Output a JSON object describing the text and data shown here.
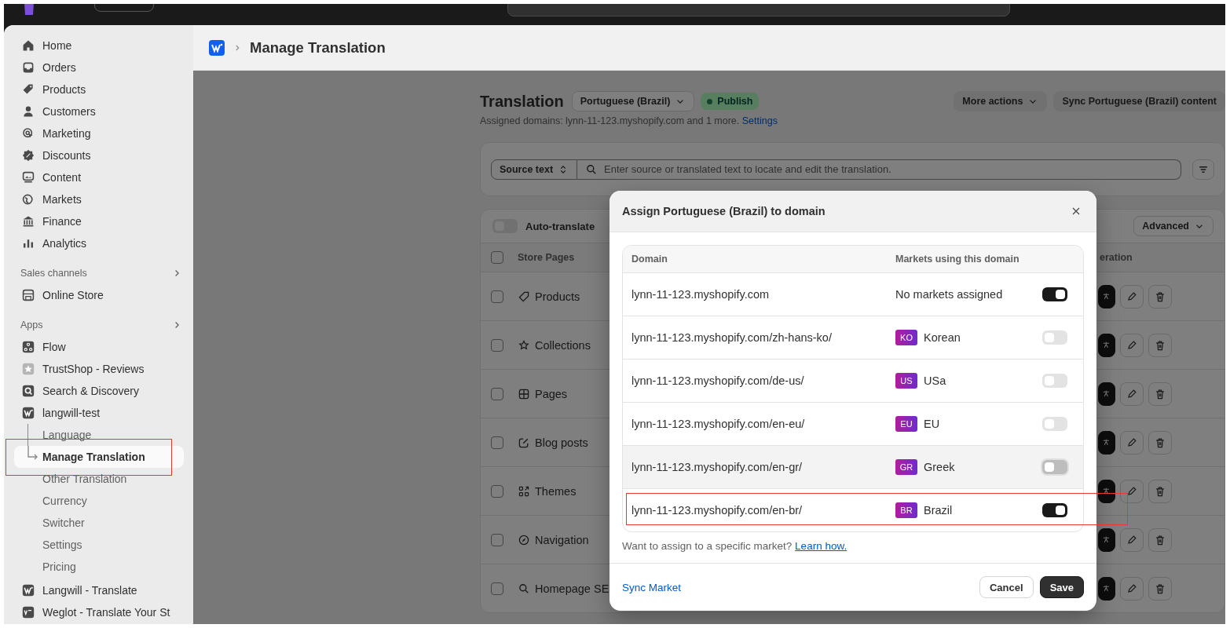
{
  "sidebar": {
    "items": [
      {
        "label": "Home"
      },
      {
        "label": "Orders"
      },
      {
        "label": "Products"
      },
      {
        "label": "Customers"
      },
      {
        "label": "Marketing"
      },
      {
        "label": "Discounts"
      },
      {
        "label": "Content"
      },
      {
        "label": "Markets"
      },
      {
        "label": "Finance"
      },
      {
        "label": "Analytics"
      }
    ],
    "sections": [
      {
        "title": "Sales channels",
        "items": [
          {
            "label": "Online Store"
          }
        ]
      },
      {
        "title": "Apps",
        "items": [
          {
            "label": "Flow"
          },
          {
            "label": "TrustShop - Reviews"
          },
          {
            "label": "Search & Discovery"
          },
          {
            "label": "langwill-test",
            "children": [
              {
                "label": "Language",
                "selected": false,
                "annotated": false
              },
              {
                "label": "Manage Translation",
                "selected": true,
                "annotated": true
              },
              {
                "label": "Other Translation",
                "selected": false,
                "annotated": false
              },
              {
                "label": "Currency",
                "selected": false,
                "annotated": false
              },
              {
                "label": "Switcher",
                "selected": false,
                "annotated": false
              },
              {
                "label": "Settings",
                "selected": false,
                "annotated": false
              },
              {
                "label": "Pricing",
                "selected": false,
                "annotated": false
              }
            ]
          },
          {
            "label": "Langwill - Translate"
          },
          {
            "label": "Weglot - Translate Your St"
          }
        ]
      }
    ]
  },
  "header": {
    "title": "Manage Translation"
  },
  "page": {
    "title": "Translation",
    "language": "Portuguese (Brazil)",
    "status": "Publish",
    "assigned_text": "Assigned domains: lynn-11-123.myshopify.com and 1 more.",
    "settings_link": "Settings",
    "actions": [
      "More actions",
      "Sync Portuguese (Brazil) content"
    ]
  },
  "filter": {
    "mode": "Source text",
    "placeholder": "Enter source or translated text to locate and edit the translation."
  },
  "auto_translate": {
    "label": "Auto-translate",
    "on": false
  },
  "advanced": "Advanced",
  "table": {
    "columns": [
      "Store Pages",
      "eration"
    ],
    "all_checked": false,
    "rows": [
      {
        "label": "Products",
        "checked": false
      },
      {
        "label": "Collections",
        "checked": false
      },
      {
        "label": "Pages",
        "checked": false
      },
      {
        "label": "Blog posts",
        "checked": false
      },
      {
        "label": "Themes",
        "checked": false
      },
      {
        "label": "Navigation",
        "checked": false
      },
      {
        "label": "Homepage SE",
        "checked": false
      }
    ]
  },
  "modal": {
    "title": "Assign Portuguese (Brazil) to domain",
    "columns": [
      "Domain",
      "Markets using this domain"
    ],
    "rows": [
      {
        "domain": "lynn-11-123.myshopify.com",
        "market": "No markets assigned",
        "on": true,
        "hovered": false,
        "annotated": false
      },
      {
        "domain": "lynn-11-123.myshopify.com/zh-hans-ko/",
        "market_code": "KO",
        "market": "Korean",
        "on": false,
        "hovered": false,
        "annotated": false
      },
      {
        "domain": "lynn-11-123.myshopify.com/de-us/",
        "market_code": "US",
        "market": "USa",
        "on": false,
        "hovered": false,
        "annotated": false
      },
      {
        "domain": "lynn-11-123.myshopify.com/en-eu/",
        "market_code": "EU",
        "market": "EU",
        "on": false,
        "hovered": false,
        "annotated": false
      },
      {
        "domain": "lynn-11-123.myshopify.com/en-gr/",
        "market_code": "GR",
        "market": "Greek",
        "on": false,
        "hovered": true,
        "annotated": false
      },
      {
        "domain": "lynn-11-123.myshopify.com/en-br/",
        "market_code": "BR",
        "market": "Brazil",
        "on": true,
        "hovered": false,
        "annotated": true
      }
    ],
    "note": "Want to assign to a specific market?",
    "note_link": "Learn how.",
    "sync_link": "Sync Market",
    "buttons": [
      "Cancel",
      "Save"
    ]
  }
}
